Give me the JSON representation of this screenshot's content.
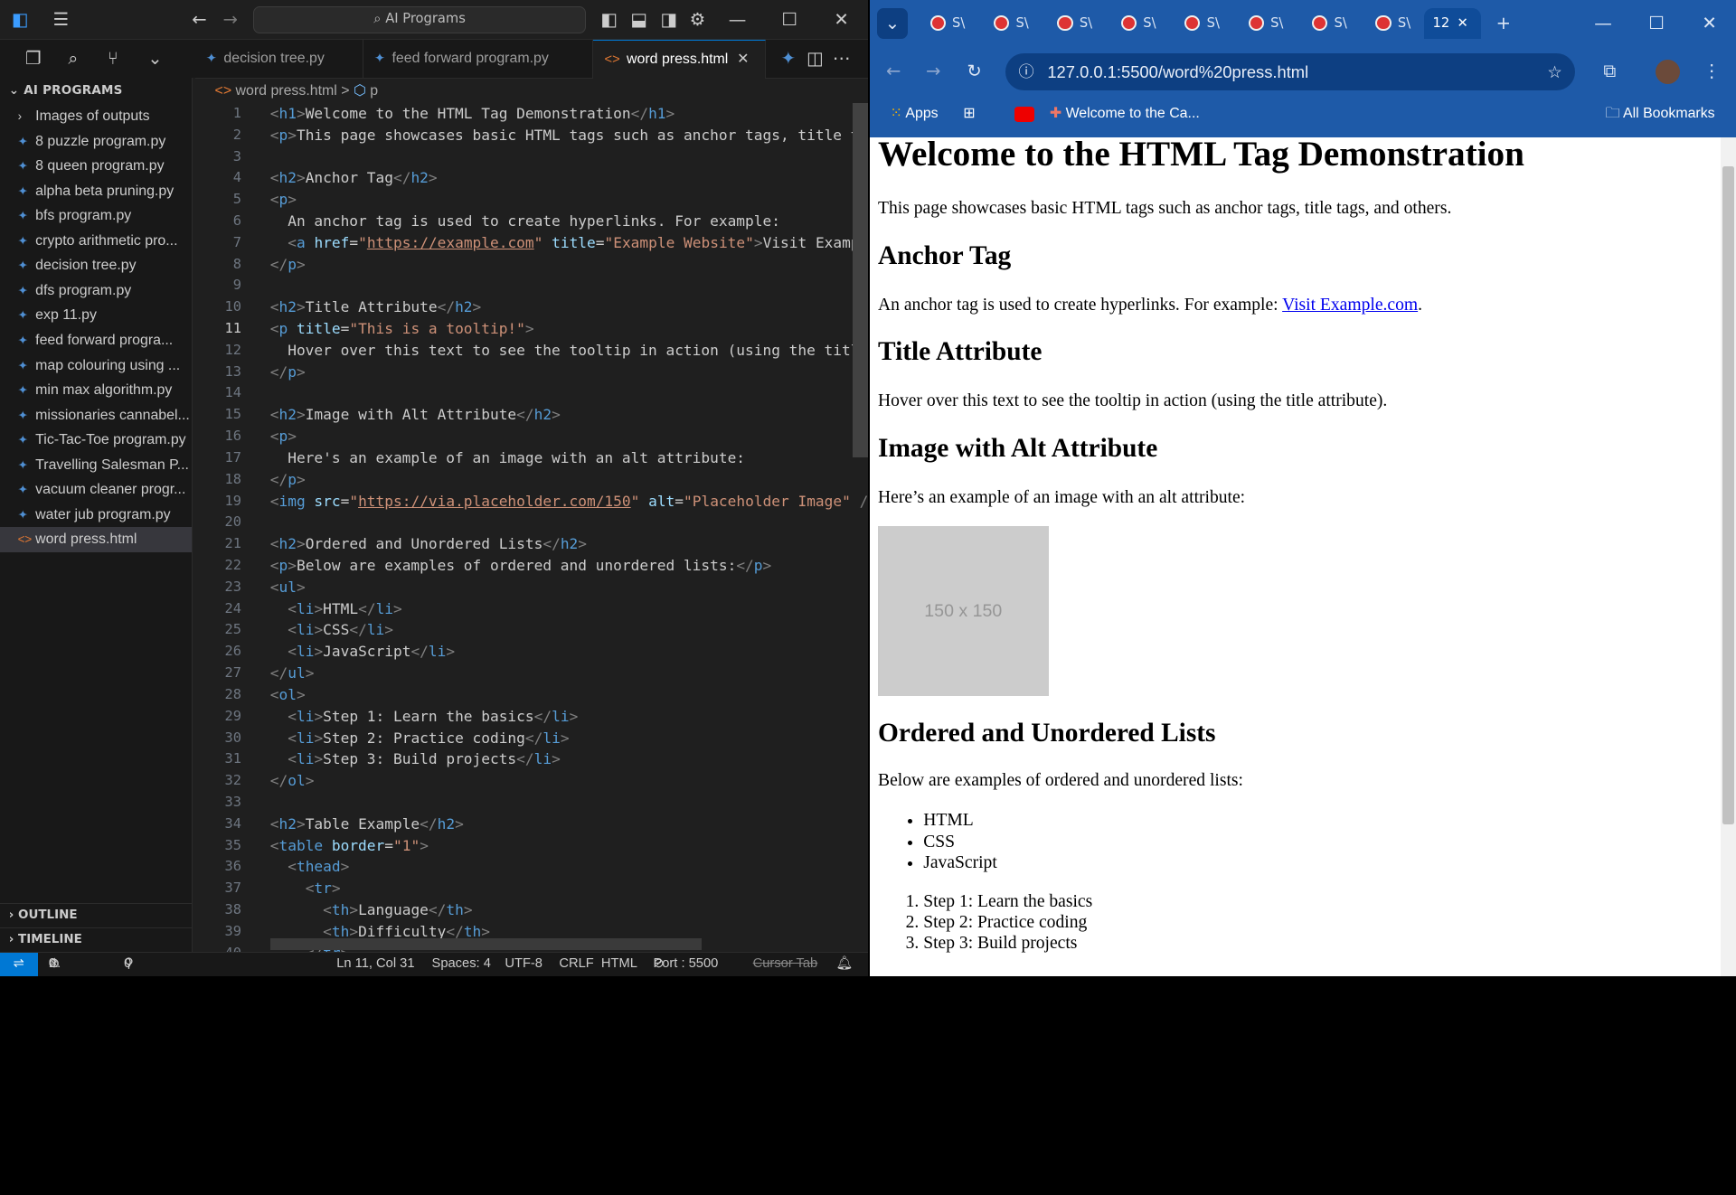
{
  "vscode": {
    "search_label": "AI Programs",
    "explorer_title": "AI PROGRAMS",
    "folder": "Images of outputs",
    "files": [
      "8 puzzle program.py",
      "8 queen program.py",
      "alpha beta pruning.py",
      "bfs program.py",
      "crypto arithmetic pro...",
      "decision tree.py",
      "dfs program.py",
      "exp 11.py",
      "feed forward progra...",
      "map colouring using ...",
      "min max algorithm.py",
      "missionaries cannabel...",
      "Tic-Tac-Toe program.py",
      "Travelling Salesman P...",
      "vacuum cleaner progr...",
      "water jub program.py"
    ],
    "selected_file": "word press.html",
    "outline_label": "OUTLINE",
    "timeline_label": "TIMELINE",
    "tabs": [
      {
        "label": "decision tree.py"
      },
      {
        "label": "feed forward program.py"
      },
      {
        "label": "word press.html"
      }
    ],
    "breadcrumb_file": "word press.html",
    "breadcrumb_sep": ">",
    "breadcrumb_symbol": "p",
    "code_lines": [
      "<h1>Welcome to the HTML Tag Demonstration</h1>",
      "<p>This page showcases basic HTML tags such as anchor tags, title tag",
      "",
      "<h2>Anchor Tag</h2>",
      "<p>",
      "  An anchor tag is used to create hyperlinks. For example:",
      "  <a href=\"https://example.com\" title=\"Example Website\">Visit Example",
      "</p>",
      "",
      "<h2>Title Attribute</h2>",
      "<p title=\"This is a tooltip!\">",
      "  Hover over this text to see the tooltip in action (using the title",
      "</p>",
      "",
      "<h2>Image with Alt Attribute</h2>",
      "<p>",
      "  Here's an example of an image with an alt attribute:",
      "</p>",
      "<img src=\"https://via.placeholder.com/150\" alt=\"Placeholder Image\" />",
      "",
      "<h2>Ordered and Unordered Lists</h2>",
      "<p>Below are examples of ordered and unordered lists:</p>",
      "<ul>",
      "  <li>HTML</li>",
      "  <li>CSS</li>",
      "  <li>JavaScript</li>",
      "</ul>",
      "<ol>",
      "  <li>Step 1: Learn the basics</li>",
      "  <li>Step 2: Practice coding</li>",
      "  <li>Step 3: Build projects</li>",
      "</ol>",
      "",
      "<h2>Table Example</h2>",
      "<table border=\"1\">",
      "  <thead>",
      "    <tr>",
      "      <th>Language</th>",
      "      <th>Difficulty</th>",
      "    </tr>"
    ],
    "current_line": 11,
    "status": {
      "errors": "0",
      "warnings": "0",
      "ports": "0",
      "position": "Ln 11, Col 31",
      "spaces": "Spaces: 4",
      "encoding": "UTF-8",
      "eol": "CRLF",
      "language": "HTML",
      "port": "Port : 5500",
      "cursor_tab": "Cursor Tab"
    }
  },
  "chrome": {
    "tabs": [
      "S\\",
      "S\\",
      "S\\",
      "S\\",
      "S\\",
      "S\\",
      "S\\",
      "S\\"
    ],
    "active_tab": "12",
    "url": "127.0.0.1:5500/word%20press.html",
    "bookmarks": {
      "apps": "Apps",
      "welcome": "Welcome to the Ca...",
      "all": "All Bookmarks"
    },
    "page": {
      "h1": "Welcome to the HTML Tag Demonstration",
      "intro": "This page showcases basic HTML tags such as anchor tags, title tags, and others.",
      "anchor_h2": "Anchor Tag",
      "anchor_text": "An anchor tag is used to create hyperlinks. For example:",
      "anchor_link": "Visit Example.com",
      "anchor_period": ".",
      "title_h2": "Title Attribute",
      "title_text": "Hover over this text to see the tooltip in action (using the title attribute).",
      "image_h2": "Image with Alt Attribute",
      "image_text": "Here’s an example of an image with an alt attribute:",
      "placeholder": "150 x 150",
      "lists_h2": "Ordered and Unordered Lists",
      "lists_text": "Below are examples of ordered and unordered lists:",
      "ul": [
        "HTML",
        "CSS",
        "JavaScript"
      ],
      "ol": [
        "Step 1: Learn the basics",
        "Step 2: Practice coding",
        "Step 3: Build projects"
      ]
    }
  },
  "colors": {
    "vscode_bg": "#1f1f1f",
    "accent": "#0078d4",
    "chrome_frame": "#1e5aa8",
    "link": "#0000ee"
  }
}
